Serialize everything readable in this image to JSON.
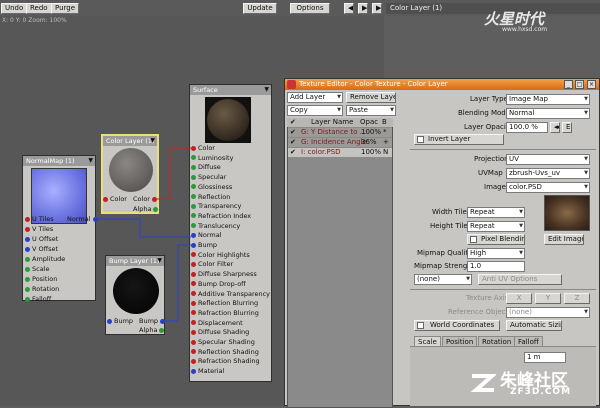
{
  "toolbar": {
    "undo": "Undo",
    "redo": "Redo",
    "purge": "Purge",
    "update": "Update",
    "options": "Options",
    "panel_title": "Color Layer (1)",
    "zoom_readout": "X: 0 Y: 0 Zoom: 100%"
  },
  "watermark_top": {
    "brand": "火星时代",
    "url": "www.hxsd.com"
  },
  "watermark_bottom": {
    "brand": "朱峰社区",
    "url": "ZF3D.COM"
  },
  "nodes": {
    "normalmap": {
      "title": "NormalMap (1)",
      "inputs": [
        "U Tiles",
        "V Tiles",
        "U Offset",
        "V Offset",
        "Amplitude",
        "Scale",
        "Position",
        "Rotation",
        "Falloff"
      ],
      "output": "Normal"
    },
    "color_layer": {
      "title": "Color Layer (1)",
      "in": "Color",
      "out": "Color",
      "alpha": "Alpha"
    },
    "bump_layer": {
      "title": "Bump Layer (1)",
      "in": "Bump",
      "out": "Bump",
      "alpha": "Alpha"
    },
    "surface": {
      "title": "Surface",
      "inputs": [
        "Color",
        "Luminosity",
        "Diffuse",
        "Specular",
        "Glossiness",
        "Reflection",
        "Transparency",
        "Refraction Index",
        "Translucency",
        "Normal",
        "Bump",
        "Color Highlights",
        "Color Filter",
        "Diffuse Sharpness",
        "Bump Drop-off",
        "Additive Transparency",
        "Reflection Blurring",
        "Refraction Blurring",
        "Displacement",
        "Diffuse Shading",
        "Specular Shading",
        "Reflection Shading",
        "Refraction Shading",
        "Material"
      ]
    }
  },
  "texture_editor": {
    "title": "Texture Editor - Color Texture - Color Layer",
    "add_layer": "Add Layer",
    "remove_layer": "Remove Layer",
    "copy": "Copy",
    "paste": "Paste",
    "columns": [
      "Layer Name",
      "Opac",
      "B"
    ],
    "layers": [
      {
        "name": "G: Y Distance to ...",
        "opacity": "100%",
        "blend": "*"
      },
      {
        "name": "G: Incidence Angle",
        "opacity": "36%",
        "blend": "+"
      },
      {
        "name": "I: color.PSD",
        "opacity": "100%",
        "blend": "N"
      }
    ],
    "layer_type_label": "Layer Type",
    "layer_type": "Image Map",
    "blending_mode_label": "Blending Mode",
    "blending_mode": "Normal",
    "layer_opacity_label": "Layer Opacity",
    "layer_opacity": "100.0 %",
    "invert_layer": "Invert Layer",
    "projection_label": "Projection",
    "projection": "UV",
    "uvmap_label": "UVMap",
    "uvmap": "zbrush-Uvs_uv",
    "image_label": "Image",
    "image": "color.PSD",
    "width_tile_label": "Width Tile",
    "width_tile": "Repeat",
    "height_tile_label": "Height Tile",
    "height_tile": "Repeat",
    "pixel_blending": "Pixel Blending",
    "edit_image": "Edit Image",
    "mipmap_quality_label": "Mipmap Quality",
    "mipmap_quality": "High",
    "mipmap_strength_label": "Mipmap Strength",
    "mipmap_strength": "1.0",
    "none_select": "(none)",
    "auto_uv": "Anti UV Options",
    "texture_axis_label": "Texture Axis",
    "axis_x": "X",
    "axis_y": "Y",
    "axis_z": "Z",
    "reference_object_label": "Reference Object",
    "reference_object": "(none)",
    "world_coordinates": "World Coordinates",
    "automatic_sizing": "Automatic Sizing",
    "tabs": [
      "Scale",
      "Position",
      "Rotation",
      "Falloff"
    ],
    "scale_x": "1 m"
  }
}
